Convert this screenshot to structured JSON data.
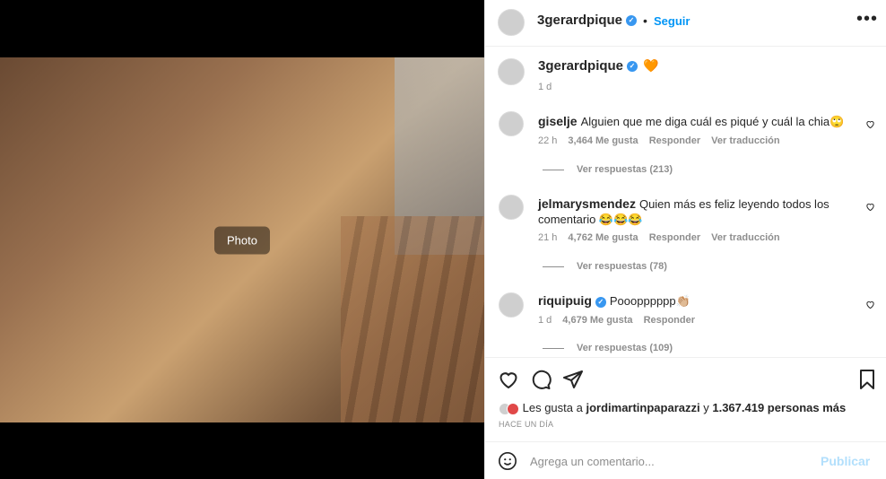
{
  "media": {
    "placeholder": "Photo"
  },
  "header": {
    "follow_label": "Seguir",
    "more_label": "•••"
  },
  "post": {
    "username": "3gerardpique",
    "caption_emoji": "🧡",
    "time": "1 d",
    "likes_prefix": "Les gusta a",
    "likes_user": "jordimartinpaparazzi",
    "likes_connector": "y",
    "likes_rest": "1.367.419 personas más",
    "ago": "HACE UN DÍA"
  },
  "comments": [
    {
      "user": "giselje",
      "text": "Alguien que me diga cuál es piqué y cuál la chia🙄",
      "time": "22 h",
      "likes": "3,464 Me gusta",
      "reply": "Responder",
      "translate": "Ver traducción",
      "replies": "Ver respuestas (213)"
    },
    {
      "user": "jelmarysmendez",
      "text": "Quien más es feliz leyendo todos los comentario 😂😂😂",
      "time": "21 h",
      "likes": "4,762 Me gusta",
      "reply": "Responder",
      "translate": "Ver traducción",
      "replies": "Ver respuestas (78)"
    },
    {
      "user": "riquipuig",
      "text": "Pooopppppp👏🏼",
      "time": "1 d",
      "likes": "4,679 Me gusta",
      "reply": "Responder",
      "translate": "",
      "replies": "Ver respuestas (109)"
    }
  ],
  "add_comment": {
    "placeholder": "Agrega un comentario...",
    "publish": "Publicar"
  }
}
